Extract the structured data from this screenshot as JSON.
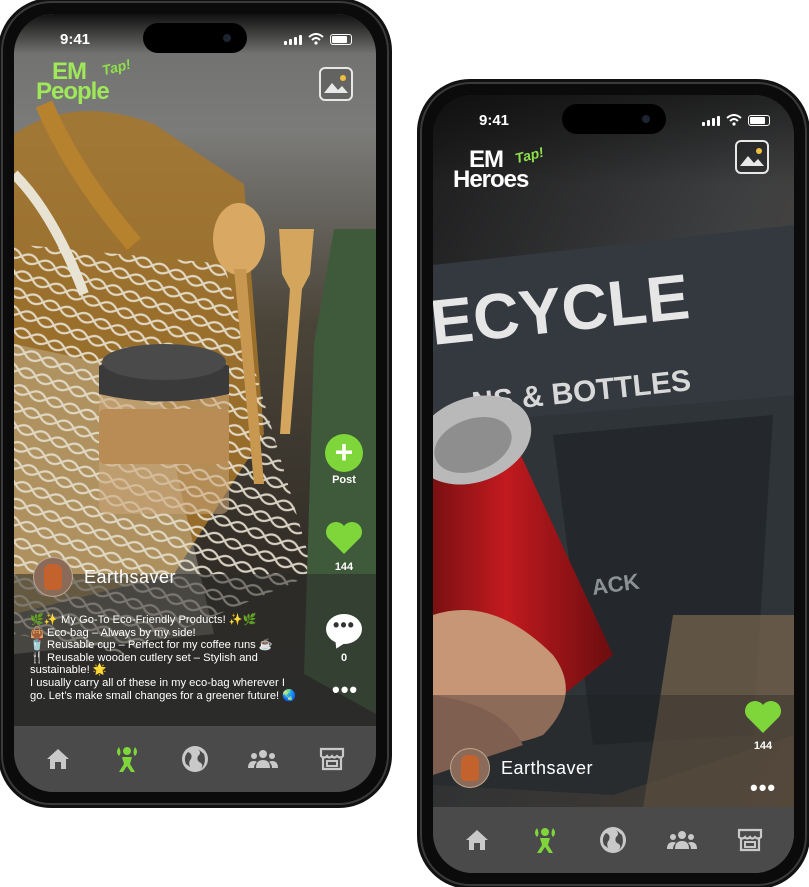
{
  "phone_left": {
    "status": {
      "time": "9:41"
    },
    "logo": {
      "line1": "EM",
      "line2": "People",
      "tap": "Tap!"
    },
    "post_label": "Post",
    "like_count": "144",
    "comment_count": "0",
    "user": {
      "name": "Earthsaver"
    },
    "caption": [
      "🌿✨ My Go-To Eco-Friendly Products! ✨🌿",
      "👜 Eco-bag – Always by my side!",
      "🥤 Reusable cup – Perfect for my coffee runs ☕",
      "🍴 Reusable wooden cutlery set – Stylish and",
      "sustainable! 🌟",
      "I usually carry all of these in my eco-bag wherever I",
      "go. Let’s make small changes for a greener future! 🌏"
    ],
    "nav": [
      "home-icon",
      "eco-person-icon",
      "earth-icon",
      "community-icon",
      "store-icon"
    ]
  },
  "phone_right": {
    "status": {
      "time": "9:41"
    },
    "logo": {
      "line1": "EM",
      "line2": "Heroes",
      "tap": "Tap!"
    },
    "sign": {
      "line1": "ECYCLE",
      "line2": "NS & BOTTLES",
      "line3": "ACK"
    },
    "like_count": "144",
    "user": {
      "name": "Earthsaver"
    },
    "nav": [
      "home-icon",
      "eco-person-icon",
      "earth-icon",
      "community-icon",
      "store-icon"
    ]
  },
  "colors": {
    "accent": "#7fd63b",
    "nav_bg": "#4a4a4a",
    "frame": "#0b0b0b"
  }
}
